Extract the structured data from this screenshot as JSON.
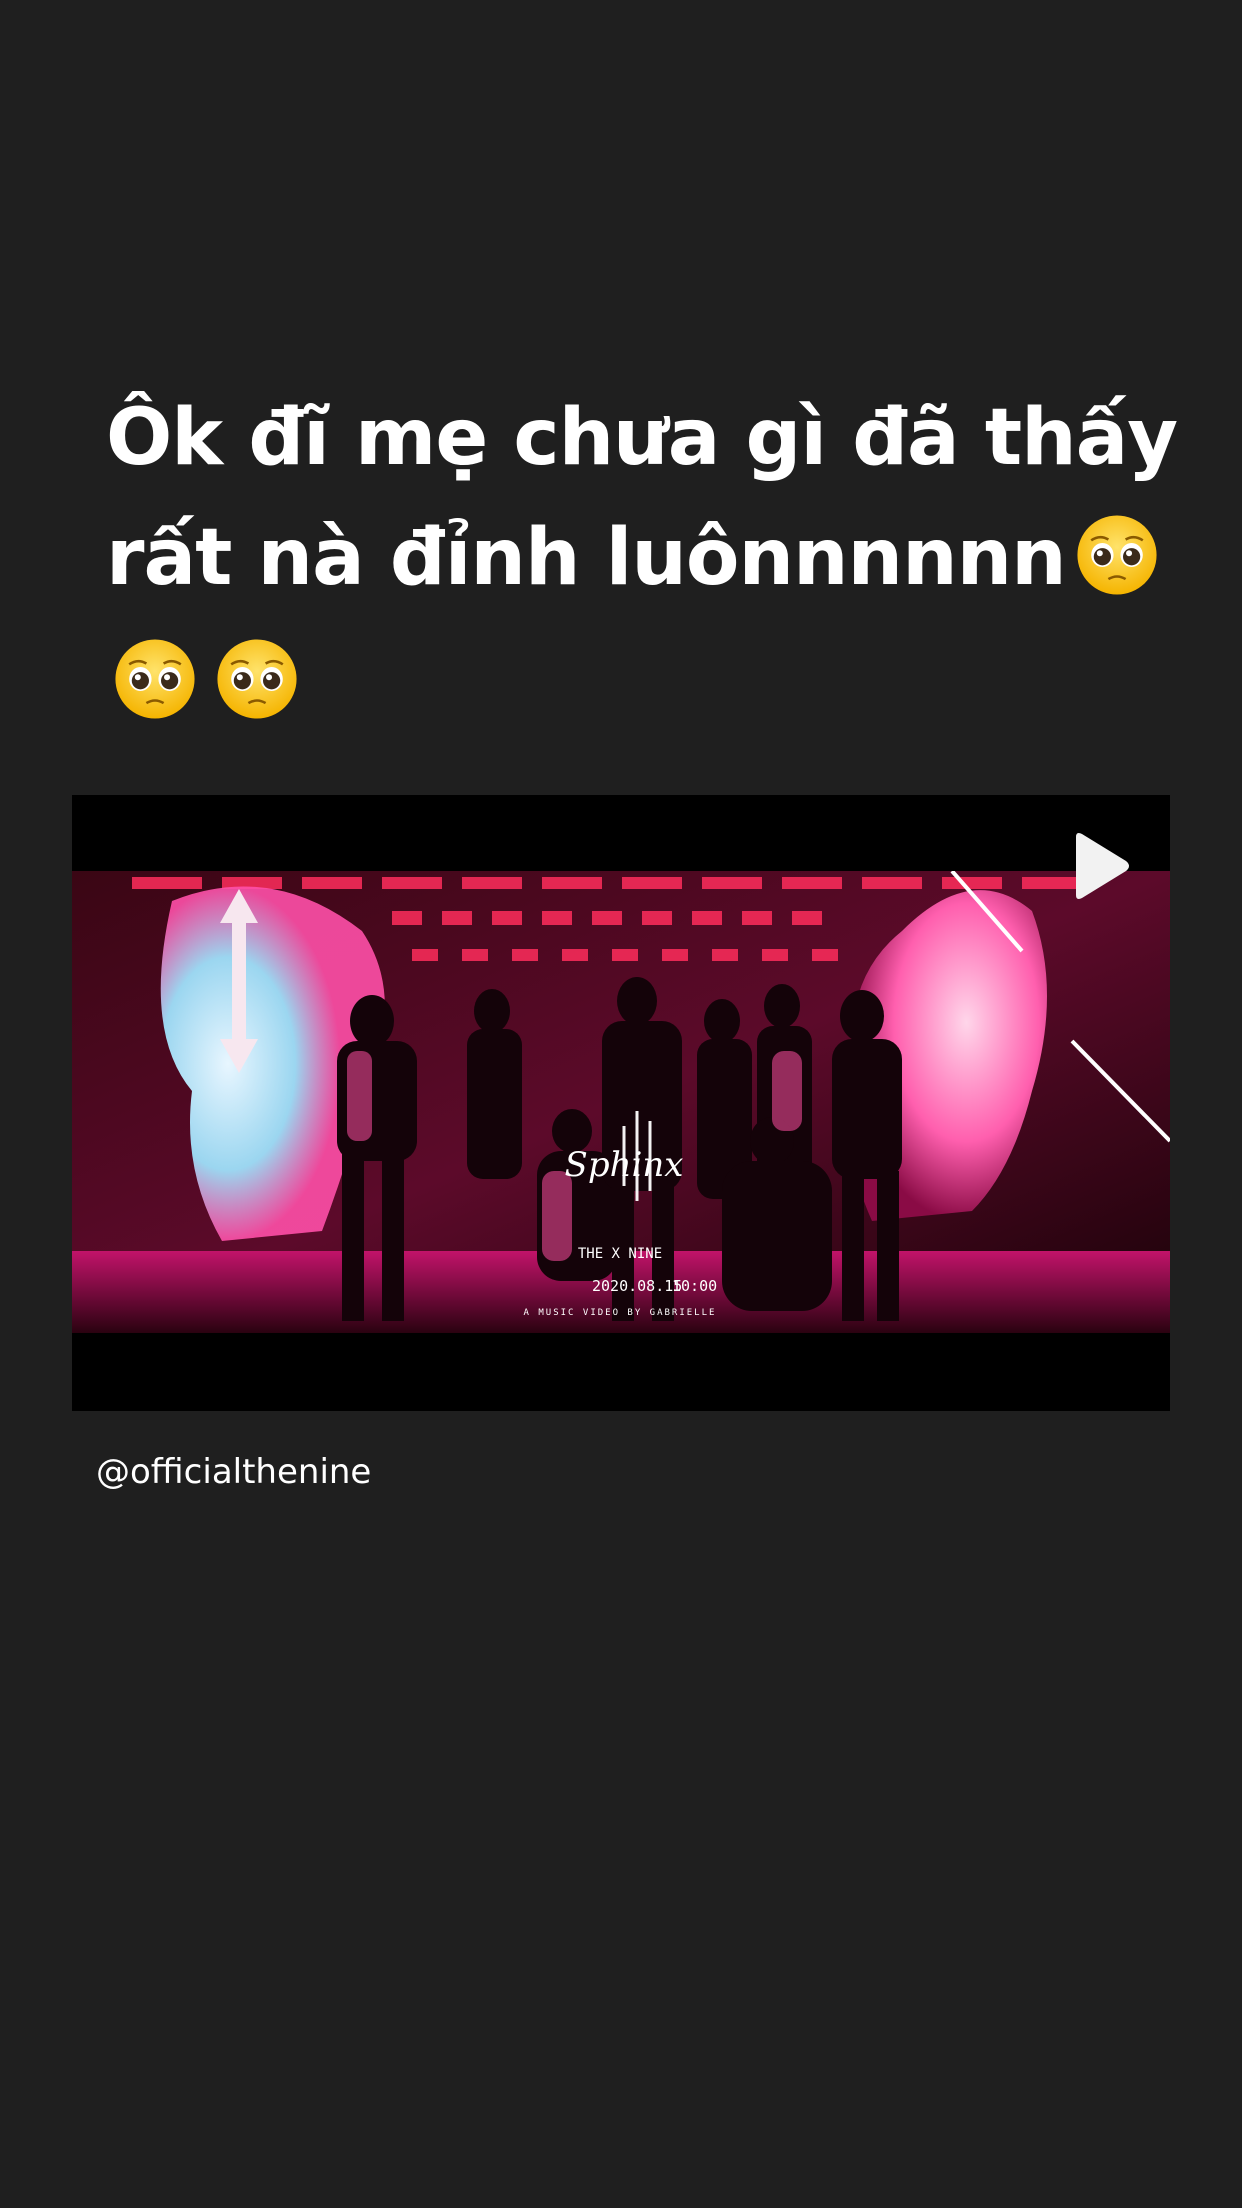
{
  "story": {
    "caption_text": "Ôk đĩ mẹ chưa gì đã thấy rất nà đỉnh luônnnnnn",
    "emojis": [
      "pleading-face-emoji",
      "pleading-face-emoji",
      "pleading-face-emoji"
    ],
    "mention": "@officialthenine"
  },
  "video": {
    "title_logo": "Sphinx",
    "date": "2020.08.15",
    "time": "10:00",
    "credit": "A MUSIC VIDEO BY GABRIELLE",
    "play_icon": "play-icon"
  },
  "colors": {
    "background": "#1f1f1f",
    "text": "#ffffff",
    "video_bg": "#000000",
    "accent_pink": "#ff2d8a"
  }
}
